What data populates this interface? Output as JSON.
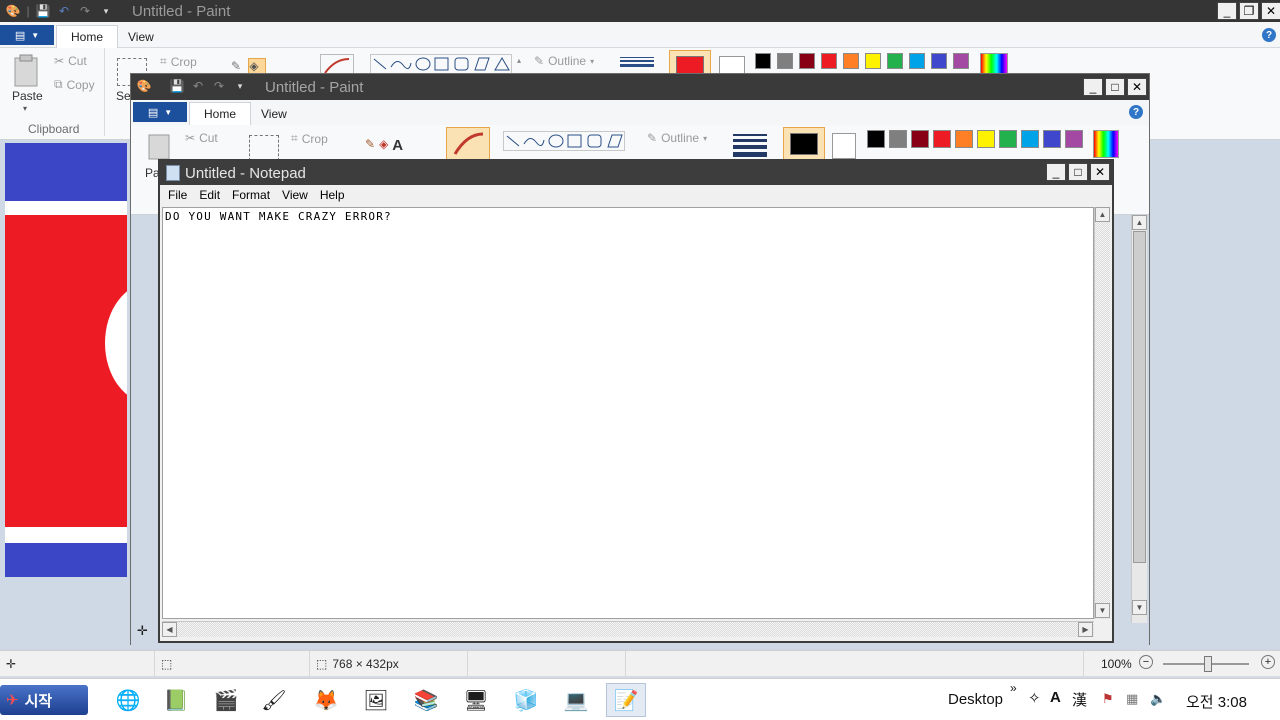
{
  "paint_main": {
    "title": "Untitled - Paint",
    "tabs": [
      "Home",
      "View"
    ],
    "ribbon": {
      "paste_label": "Paste",
      "cut_label": "Cut",
      "copy_label": "Copy",
      "select_label": "Se",
      "crop_label": "Crop",
      "outline_label": "Outline",
      "clipboard_group_label": "Clipboard"
    },
    "palette": [
      "#000000",
      "#7f7f7f",
      "#880015",
      "#ed1c24",
      "#ff7f27",
      "#fff200",
      "#22b14c",
      "#00a2e8",
      "#3f48cc",
      "#a349a4"
    ],
    "status": {
      "dimensions": "768 × 432px",
      "zoom": "100%"
    }
  },
  "paint_second": {
    "title": "Untitled - Paint",
    "tabs": [
      "Home",
      "View"
    ],
    "ribbon": {
      "paste_label": "Pa",
      "cut_label": "Cut",
      "crop_label": "Crop",
      "outline_label": "Outline"
    },
    "palette": [
      "#000000",
      "#7f7f7f",
      "#880015",
      "#ed1c24",
      "#ff7f27",
      "#fff200",
      "#22b14c",
      "#00a2e8",
      "#3f48cc",
      "#a349a4"
    ]
  },
  "notepad": {
    "title": "Untitled - Notepad",
    "menu": [
      "File",
      "Edit",
      "Format",
      "View",
      "Help"
    ],
    "content": "DO YOU WANT MAKE CRAZY ERROR?"
  },
  "taskbar": {
    "start_label": "시작",
    "desktop_label": "Desktop",
    "ime_a": "A",
    "ime_han": "漢",
    "clock": "오전 3:08"
  },
  "colors": {
    "flag_blue": "#3b46c6",
    "flag_red": "#ed1c24",
    "title_dark": "#353535",
    "accent_blue": "#1c4f9c"
  }
}
